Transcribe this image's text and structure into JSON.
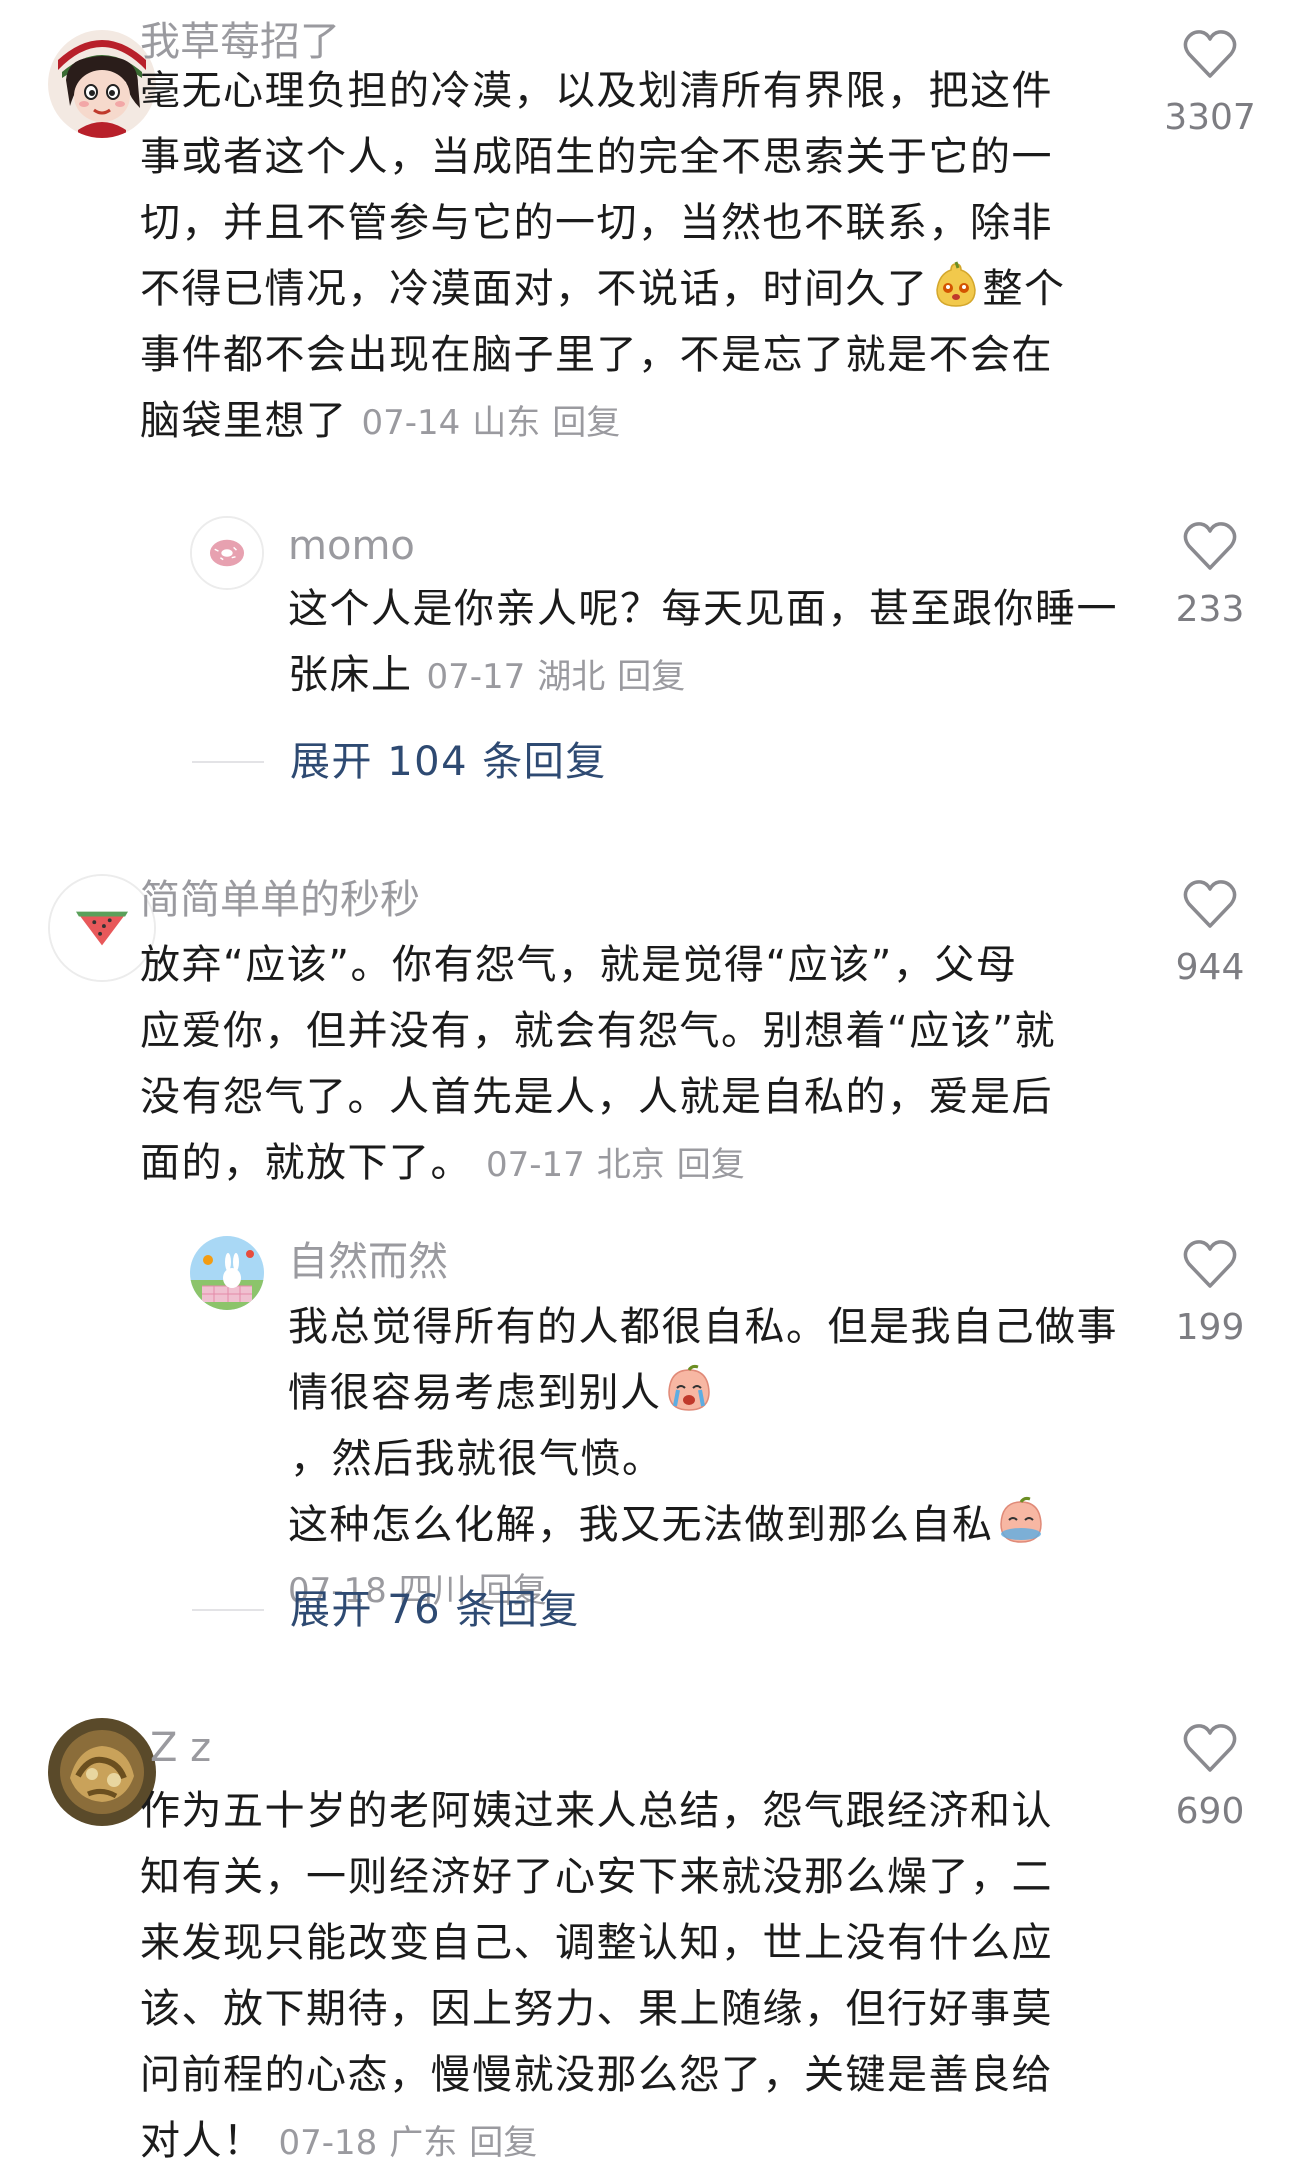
{
  "comments": [
    {
      "username": "我草莓招了",
      "lines": [
        "毫无心理负担的冷漠，以及划清所有界限，把这件",
        "事或者这个人，当成陌生的完全不思索关于它的一",
        "切，并且不管参与它的一切，当然也不联系，除非",
        "不得已情况，冷漠面对，不说话，时间久了",
        "整个",
        "事件都不会出现在脑子里了，不是忘了就是不会在",
        "脑袋里想了"
      ],
      "date": "07-14",
      "location": "山东",
      "reply_label": "回复",
      "likes": "3307",
      "emoji_icon": "pear-face-emoji"
    },
    {
      "username": "momo",
      "lines": [
        "这个人是你亲人呢？每天见面，甚至跟你睡一",
        "张床上"
      ],
      "date": "07-17",
      "location": "湖北",
      "reply_label": "回复",
      "likes": "233"
    },
    {
      "username": "简简单单的秒秒",
      "lines": [
        "放弃“应该”。你有怨气，就是觉得“应该”，父母",
        "应爱你，但并没有，就会有怨气。别想着“应该”就",
        "没有怨气了。人首先是人，人就是自私的，爱是后",
        "面的，就放下了。"
      ],
      "date": "07-17",
      "location": "北京",
      "reply_label": "回复",
      "likes": "944"
    },
    {
      "username": "自然而然",
      "lines": [
        "我总觉得所有的人都很自私。但是我自己做事",
        "情很容易考虑到别人",
        "，然后我就很气愤。",
        "这种怎么化解，我又无法做到那么自私"
      ],
      "date": "07-18",
      "location": "四川",
      "reply_label": "回复",
      "likes": "199",
      "emoji_icon": "crying-peach-emoji"
    },
    {
      "username": "Z z",
      "lines": [
        "作为五十岁的老阿姨过来人总结，怨气跟经济和认",
        "知有关，一则经济好了心安下来就没那么燥了，二",
        "来发现只能改变自己、调整认知，世上没有什么应",
        "该、放下期待，因上努力、果上随缘，但行好事莫",
        "问前程的心态，慢慢就没那么怨了，关键是善良给",
        "对人！"
      ],
      "date": "07-18",
      "location": "广东",
      "reply_label": "回复",
      "likes": "690"
    }
  ],
  "expand_replies": [
    {
      "label": "展开 104 条回复"
    },
    {
      "label": "展开 76 条回复"
    }
  ],
  "colors": {
    "text": "#1b1b1b",
    "meta": "#9a9a9f",
    "link": "#2e4a72",
    "heart": "#8a8a8f"
  }
}
